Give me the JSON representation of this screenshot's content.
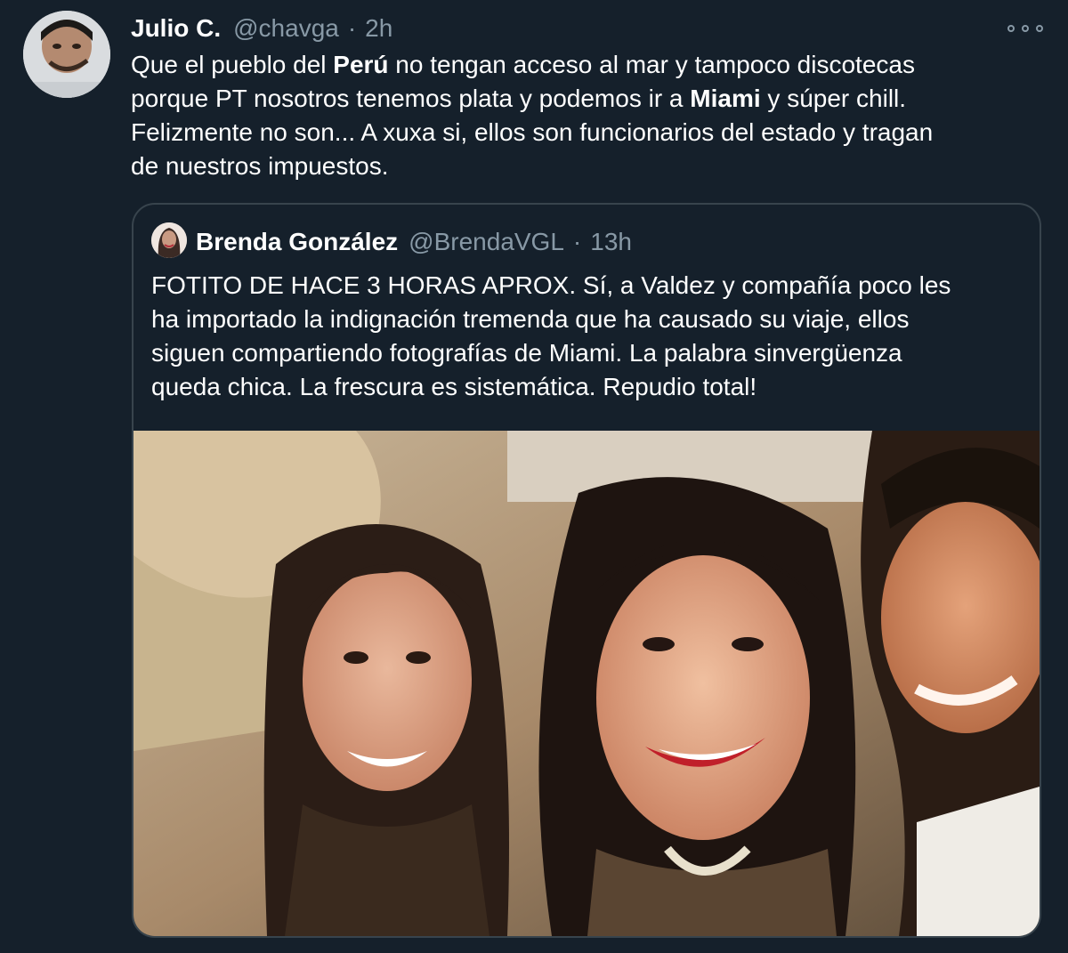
{
  "tweet": {
    "display_name": "Julio C.",
    "handle": "@chavga",
    "separator": "·",
    "time": "2h",
    "avatar_icon": "user-avatar",
    "more_icon": "more-options-icon",
    "text_lines": [
      [
        "Que el pueblo del ",
        "Perú",
        " no tengan acceso al mar y tampoco discotecas"
      ],
      [
        "porque PT nosotros tenemos plata y podemos ir a ",
        "Miami",
        " y súper chill."
      ],
      [
        "Felizmente no son... A xuxa si, ellos son funcionarios del estado y tragan"
      ],
      [
        "de nuestros impuestos."
      ]
    ]
  },
  "quote": {
    "display_name": "Brenda González",
    "handle": "@BrendaVGL",
    "separator": "·",
    "time": "13h",
    "text_lines": [
      "FOTITO DE HACE 3 HORAS APROX. Sí, a Valdez y compañía poco les",
      "ha importado la indignación tremenda que ha causado su viaje, ellos",
      "siguen compartiendo fotografías de Miami. La palabra sinvergüenza",
      "queda chica. La frescura es sistemática. Repudio total!"
    ],
    "photo_icon": "selfie-photo"
  },
  "colors": {
    "background": "#15202b",
    "text": "#ffffff",
    "secondary": "#8899a6",
    "border": "#38444d"
  }
}
